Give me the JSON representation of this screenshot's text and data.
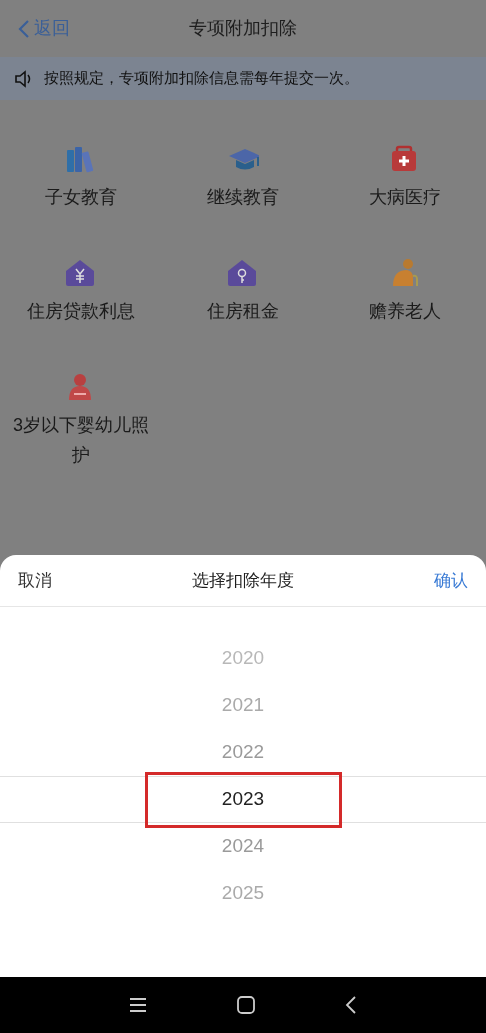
{
  "header": {
    "back_label": "返回",
    "title": "专项附加扣除"
  },
  "notice": "按照规定，专项附加扣除信息需每年提交一次。",
  "categories": [
    {
      "label": "子女教育",
      "kind": "books"
    },
    {
      "label": "继续教育",
      "kind": "cap"
    },
    {
      "label": "大病医疗",
      "kind": "medkit"
    },
    {
      "label": "住房贷款利息",
      "kind": "house-yen"
    },
    {
      "label": "住房租金",
      "kind": "house-key"
    },
    {
      "label": "赡养老人",
      "kind": "elder"
    },
    {
      "label": "3岁以下婴幼儿照护",
      "kind": "mother"
    }
  ],
  "sheet": {
    "cancel": "取消",
    "title": "选择扣除年度",
    "confirm": "确认",
    "years": [
      {
        "label": "2020",
        "selected": false,
        "highlighted": false
      },
      {
        "label": "2021",
        "selected": false,
        "highlighted": false
      },
      {
        "label": "2022",
        "selected": false,
        "highlighted": false
      },
      {
        "label": "2023",
        "selected": true,
        "highlighted": true
      },
      {
        "label": "2024",
        "selected": false,
        "highlighted": false
      },
      {
        "label": "2025",
        "selected": false,
        "highlighted": false
      }
    ]
  }
}
